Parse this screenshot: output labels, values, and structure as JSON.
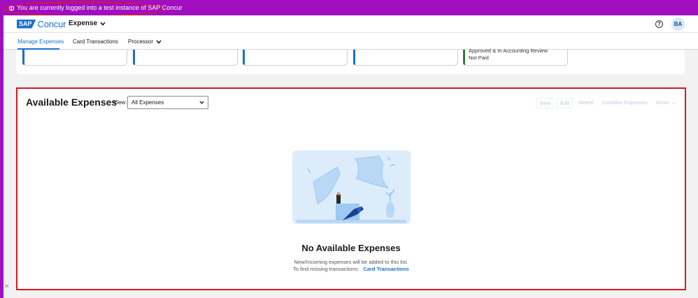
{
  "banner": {
    "text": "You are currently logged into a test instance of SAP Concur"
  },
  "appbar": {
    "logo_sap": "SAP",
    "logo_concur": "Concur",
    "app_menu": "Expense",
    "help_icon": "question-circle-icon",
    "avatar_initials": "BA"
  },
  "nav": {
    "tabs": [
      {
        "label": "Manage Expenses",
        "active": true
      },
      {
        "label": "Card Transactions",
        "active": false
      },
      {
        "label": "Processor",
        "active": false,
        "has_dropdown": true
      }
    ]
  },
  "report_tiles": {
    "last_tile": {
      "line1": "Approved & In Accounting Review",
      "line2": "Not Paid"
    }
  },
  "available_expenses": {
    "title": "Available Expenses",
    "view_label": "View:",
    "view_value": "All Expenses",
    "actions": [
      "View",
      "Edit",
      "Delete",
      "Combine Expenses",
      "Move"
    ],
    "empty_title": "No Available Expenses",
    "empty_line1": "New/Incoming expenses will be added to this list.",
    "empty_line2": "To find missing transactions:",
    "empty_link": "Card Transactions"
  },
  "colors": {
    "banner": "#a10ec0",
    "accent": "#1a6fd0",
    "highlight": "#d8191f",
    "status_green": "#2e7d32"
  }
}
